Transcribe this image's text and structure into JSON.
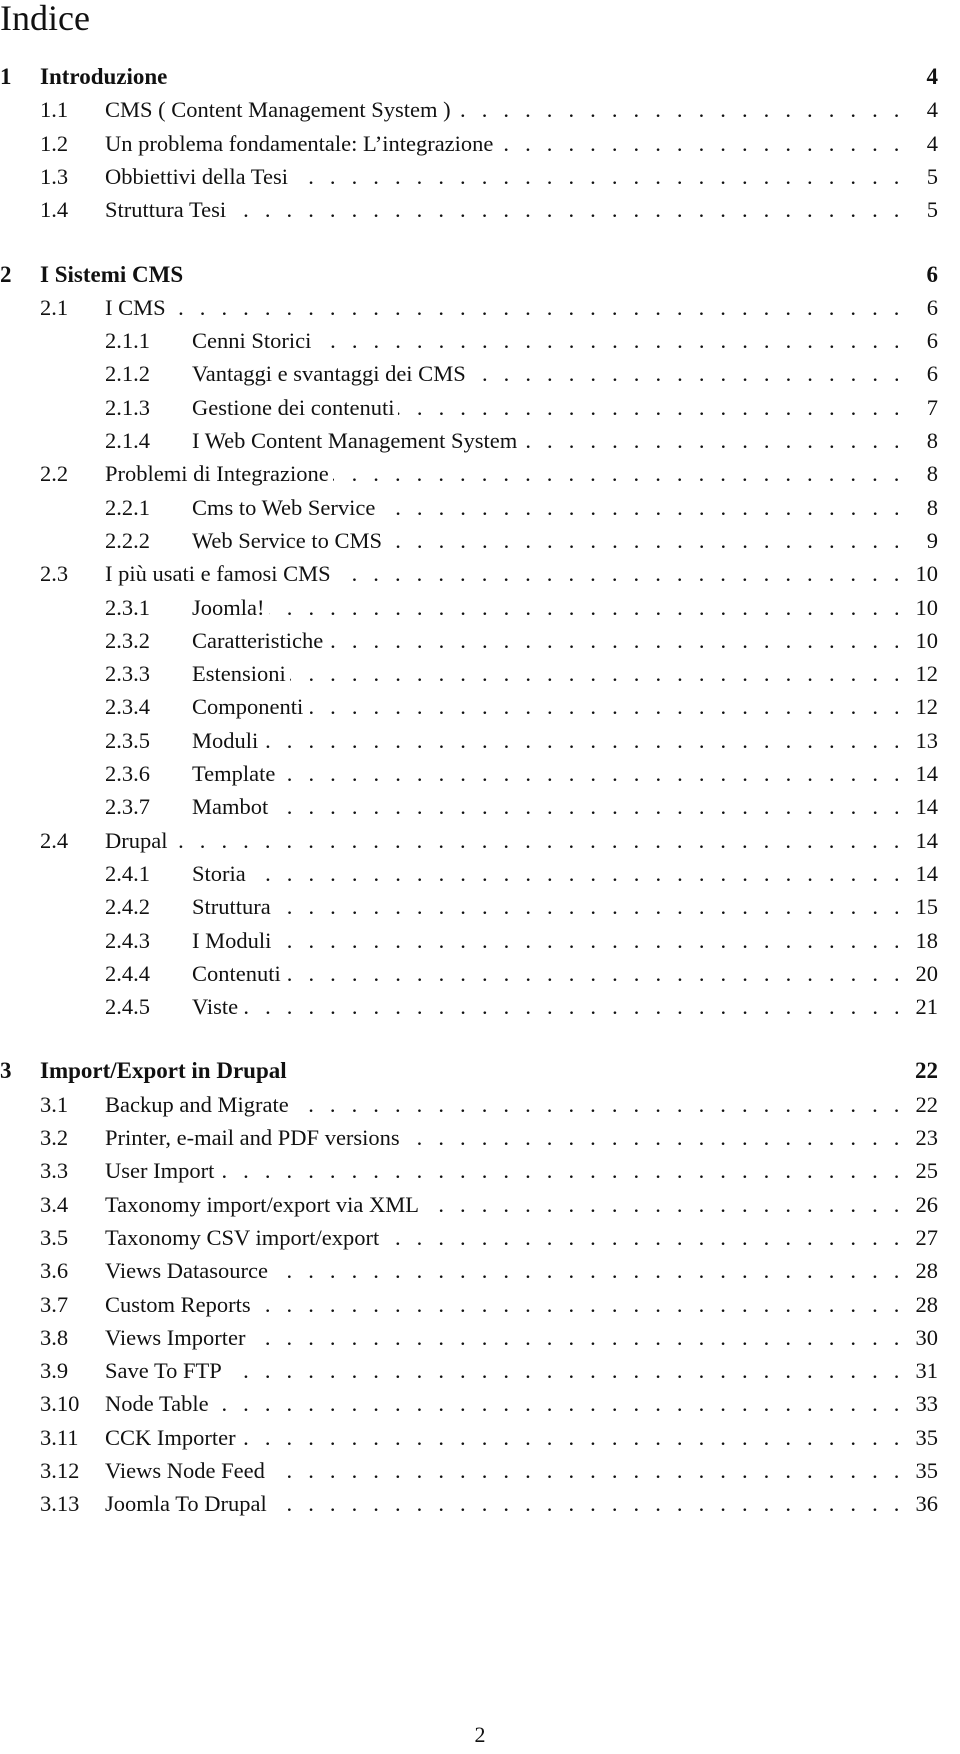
{
  "document": {
    "title": "Indice",
    "page_number": "2"
  },
  "toc": [
    {
      "level": 0,
      "num": "1",
      "title": "Introduzione",
      "page": "4"
    },
    {
      "level": 1,
      "num": "1.1",
      "title": "CMS ( Content Management System )",
      "page": "4"
    },
    {
      "level": 1,
      "num": "1.2",
      "title": "Un problema fondamentale: L’integrazione",
      "page": "4"
    },
    {
      "level": 1,
      "num": "1.3",
      "title": "Obbiettivi della Tesi",
      "page": "5"
    },
    {
      "level": 1,
      "num": "1.4",
      "title": "Struttura Tesi",
      "page": "5"
    },
    {
      "level": 0,
      "num": "2",
      "title": "I Sistemi CMS",
      "page": "6"
    },
    {
      "level": 1,
      "num": "2.1",
      "title": "I CMS",
      "page": "6"
    },
    {
      "level": 2,
      "num": "2.1.1",
      "title": "Cenni Storici",
      "page": "6"
    },
    {
      "level": 2,
      "num": "2.1.2",
      "title": "Vantaggi e svantaggi dei CMS",
      "page": "6"
    },
    {
      "level": 2,
      "num": "2.1.3",
      "title": "Gestione dei contenuti",
      "page": "7"
    },
    {
      "level": 2,
      "num": "2.1.4",
      "title": "I Web Content Management System",
      "page": "8"
    },
    {
      "level": 1,
      "num": "2.2",
      "title": "Problemi di Integrazione",
      "page": "8"
    },
    {
      "level": 2,
      "num": "2.2.1",
      "title": "Cms to Web Service",
      "page": "8"
    },
    {
      "level": 2,
      "num": "2.2.2",
      "title": "Web Service to CMS",
      "page": "9"
    },
    {
      "level": 1,
      "num": "2.3",
      "title": "I più usati e famosi CMS",
      "page": "10"
    },
    {
      "level": 2,
      "num": "2.3.1",
      "title": "Joomla!",
      "page": "10"
    },
    {
      "level": 2,
      "num": "2.3.2",
      "title": "Caratteristiche",
      "page": "10"
    },
    {
      "level": 2,
      "num": "2.3.3",
      "title": "Estensioni",
      "page": "12"
    },
    {
      "level": 2,
      "num": "2.3.4",
      "title": "Componenti",
      "page": "12"
    },
    {
      "level": 2,
      "num": "2.3.5",
      "title": "Moduli",
      "page": "13"
    },
    {
      "level": 2,
      "num": "2.3.6",
      "title": "Template",
      "page": "14"
    },
    {
      "level": 2,
      "num": "2.3.7",
      "title": "Mambot",
      "page": "14"
    },
    {
      "level": 1,
      "num": "2.4",
      "title": "Drupal",
      "page": "14"
    },
    {
      "level": 2,
      "num": "2.4.1",
      "title": "Storia",
      "page": "14"
    },
    {
      "level": 2,
      "num": "2.4.2",
      "title": "Struttura",
      "page": "15"
    },
    {
      "level": 2,
      "num": "2.4.3",
      "title": "I Moduli",
      "page": "18"
    },
    {
      "level": 2,
      "num": "2.4.4",
      "title": "Contenuti",
      "page": "20"
    },
    {
      "level": 2,
      "num": "2.4.5",
      "title": "Viste",
      "page": "21"
    },
    {
      "level": 0,
      "num": "3",
      "title": "Import/Export in Drupal",
      "page": "22"
    },
    {
      "level": 1,
      "num": "3.1",
      "title": "Backup and Migrate",
      "page": "22"
    },
    {
      "level": 1,
      "num": "3.2",
      "title": "Printer, e-mail and PDF versions",
      "page": "23"
    },
    {
      "level": 1,
      "num": "3.3",
      "title": "User Import",
      "page": "25"
    },
    {
      "level": 1,
      "num": "3.4",
      "title": "Taxonomy import/export via XML",
      "page": "26"
    },
    {
      "level": 1,
      "num": "3.5",
      "title": "Taxonomy CSV import/export",
      "page": "27"
    },
    {
      "level": 1,
      "num": "3.6",
      "title": "Views Datasource",
      "page": "28"
    },
    {
      "level": 1,
      "num": "3.7",
      "title": "Custom Reports",
      "page": "28"
    },
    {
      "level": 1,
      "num": "3.8",
      "title": "Views Importer",
      "page": "30"
    },
    {
      "level": 1,
      "num": "3.9",
      "title": "Save To FTP",
      "page": "31"
    },
    {
      "level": 1,
      "num": "3.10",
      "title": "Node Table",
      "page": "33"
    },
    {
      "level": 1,
      "num": "3.11",
      "title": "CCK Importer",
      "page": "35"
    },
    {
      "level": 1,
      "num": "3.12",
      "title": "Views Node Feed",
      "page": "35"
    },
    {
      "level": 1,
      "num": "3.13",
      "title": "Joomla To Drupal",
      "page": "36"
    }
  ]
}
